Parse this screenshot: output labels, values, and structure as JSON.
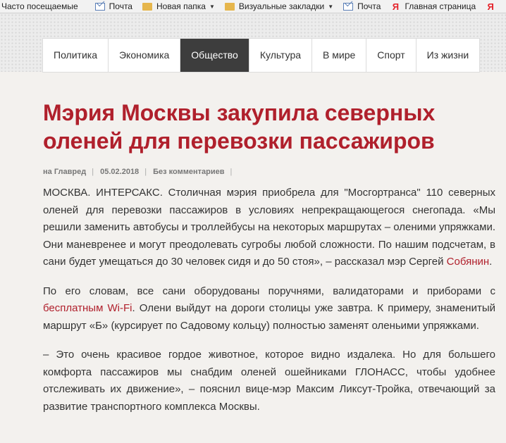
{
  "bookmarks": [
    {
      "label": "Часто посещаемые",
      "icon": "none"
    },
    {
      "label": "Почта",
      "icon": "mail-icon"
    },
    {
      "label": "Новая папка",
      "icon": "none",
      "dropdown": true
    },
    {
      "label": "Визуальные закладки",
      "icon": "none",
      "dropdown": true
    },
    {
      "label": "Почта",
      "icon": "mail-icon"
    },
    {
      "label": "Главная страница",
      "icon": "yandex-icon"
    },
    {
      "label": "Я",
      "icon": "yandex-icon"
    }
  ],
  "nav": {
    "items": [
      "Политика",
      "Экономика",
      "Общество",
      "Культура",
      "В мире",
      "Спорт",
      "Из жизни"
    ],
    "active": "Общество"
  },
  "article": {
    "title": "Мэрия Москвы закупила северных оленей для перевозки пассажиров",
    "meta": {
      "author": "на Главред",
      "date": "05.02.2018",
      "comments": "Без комментариев"
    },
    "p1_a": "МОСКВА. ИНТЕРСАКС. Столичная мэрия приобрела для \"Мосгортранса\" 110 северных оленей для перевозки пассажиров в условиях непрекращающегося снегопада. «Мы решили заменить автобусы и троллейбусы на некоторых маршрутах – оленими упряжками. Они маневренее и могут преодолевать сугробы любой сложности. По нашим подсчетам, в сани будет умещаться до 30 человек сидя и до 50 стоя», – рассказал мэр Сергей ",
    "p1_link": "Собянин",
    "p1_b": ".",
    "p2_a": "По его словам, все сани оборудованы поручнями, валидаторами и приборами с ",
    "p2_link": "бесплатным Wi-Fi",
    "p2_b": ". Олени выйдут на дороги столицы уже завтра. К примеру, знаменитый маршрут «Б» (курсирует по Садовому кольцу) полностью заменят оленьими упряжками.",
    "p3": "– Это очень красивое гордое животное, которое видно издалека. Но для большего комфорта пассажиров мы снабдим оленей ошейниками ГЛОНАСС, чтобы удобнее отслеживать их движение», – пояснил вице-мэр Максим Ликсут-Тройка, отвечающий за развитие транспортного комплекса Москвы."
  },
  "colors": {
    "accent": "#b0202c",
    "nav_active": "#3d3d3d",
    "background": "#f3f1ee"
  }
}
